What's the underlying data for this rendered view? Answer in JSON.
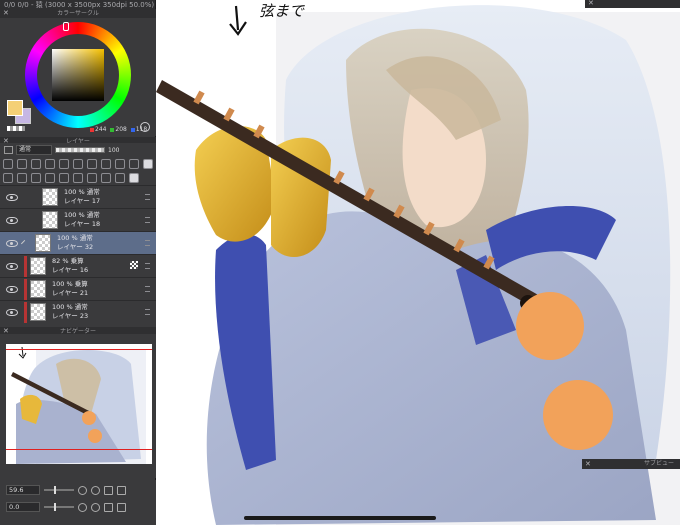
{
  "window": {
    "title": "0/0 0/0 - 猿 (3000 x 3500px 350dpi 50.0%)"
  },
  "color_panel": {
    "title": "カラーサークル",
    "main_color": "#f4d076",
    "sub_color": "#c6b7e4",
    "r": "244",
    "g": "208",
    "b": "118"
  },
  "layer_panel": {
    "title": "レイヤー",
    "blend_mode": "通常",
    "opacity": "100",
    "layers": [
      {
        "mode": "100 % 通常",
        "name": "レイヤー 17"
      },
      {
        "mode": "100 % 通常",
        "name": "レイヤー 18"
      },
      {
        "mode": "100 % 通常",
        "name": "レイヤー 32"
      },
      {
        "mode": "82 % 乗算",
        "name": "レイヤー 16"
      },
      {
        "mode": "100 % 乗算",
        "name": "レイヤー 21"
      },
      {
        "mode": "100 % 通常",
        "name": "レイヤー 23"
      }
    ]
  },
  "navigator": {
    "title": "ナビゲーター",
    "zoom": "59.6",
    "rotation": "0.0"
  },
  "preview_panel": {
    "title": "サブビュー"
  },
  "canvas": {
    "scribble_text": "弦まで",
    "accent_color": "#f2a25a"
  },
  "colors": {
    "panel_bg": "#3a3a3c",
    "selected_layer": "#5d6d8a",
    "clip_red": "#b73434",
    "orange_dot": "#f2a25a"
  }
}
